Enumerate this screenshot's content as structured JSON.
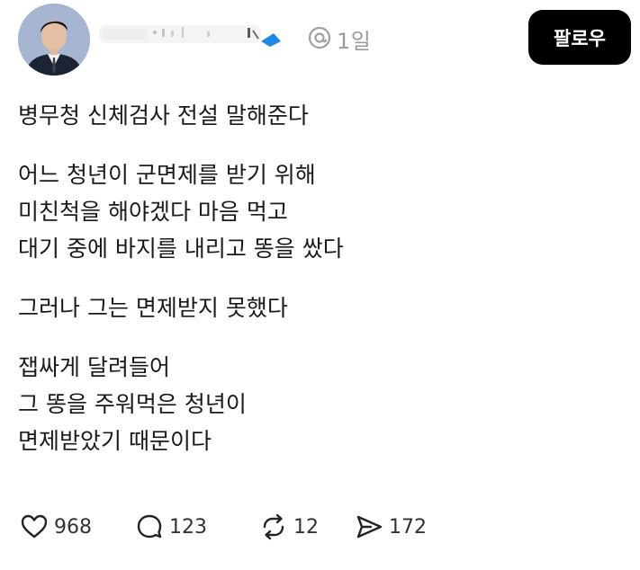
{
  "header": {
    "time": "1일",
    "follow_label": "팔로우"
  },
  "icons": {
    "avatar": "profile-photo",
    "meta": "threads-icon",
    "like": "heart-icon",
    "reply": "comment-icon",
    "repost": "repost-icon",
    "share": "send-icon"
  },
  "post": {
    "paragraphs": [
      [
        "병무청 신체검사 전설 말해준다"
      ],
      [
        "어느 청년이 군면제를 받기 위해",
        "미친척을 해야겠다 마음 먹고",
        "대기 중에 바지를 내리고 똥을 쌌다"
      ],
      [
        "그러나 그는 면제받지 못했다"
      ],
      [
        "잽싸게 달려들어",
        "그 똥을 주워먹은 청년이",
        "면제받았기 때문이다"
      ]
    ]
  },
  "actions": {
    "likes": "968",
    "replies": "123",
    "reposts": "12",
    "shares": "172"
  },
  "colors": {
    "follow_bg": "#000000",
    "meta_gray": "#9a9a9a",
    "censor_blue": "#1e88e5"
  }
}
